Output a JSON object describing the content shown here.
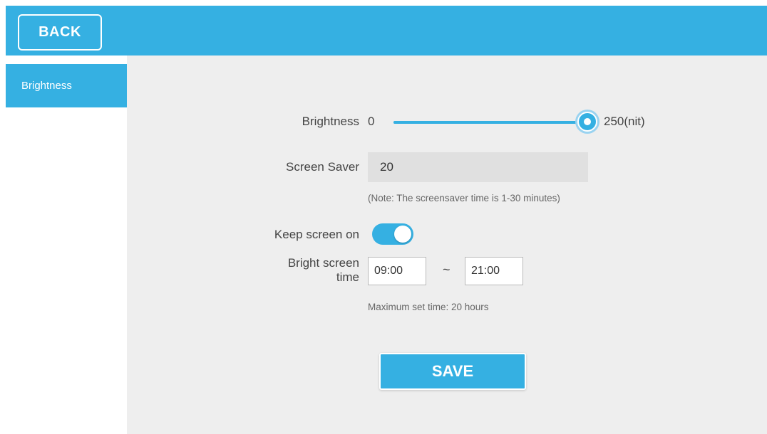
{
  "header": {
    "back_label": "BACK"
  },
  "sidebar": {
    "items": [
      {
        "label": "Brightness"
      }
    ]
  },
  "settings": {
    "brightness": {
      "label": "Brightness",
      "min_label": "0",
      "max_label": "250(nit)",
      "min": 0,
      "max": 250,
      "value": 250
    },
    "screen_saver": {
      "label": "Screen Saver",
      "value": "20",
      "note": "(Note: The screensaver time is 1-30 minutes)"
    },
    "keep_screen_on": {
      "label": "Keep screen on",
      "enabled": true
    },
    "bright_screen_time": {
      "label_line1": "Bright screen",
      "label_line2": "time",
      "start": "09:00",
      "separator": "~",
      "end": "21:00",
      "note": "Maximum set time: 20 hours"
    },
    "save_label": "SAVE"
  },
  "colors": {
    "accent": "#35b0e2",
    "content_bg": "#eeeeee",
    "input_bg": "#e0e0e0"
  }
}
